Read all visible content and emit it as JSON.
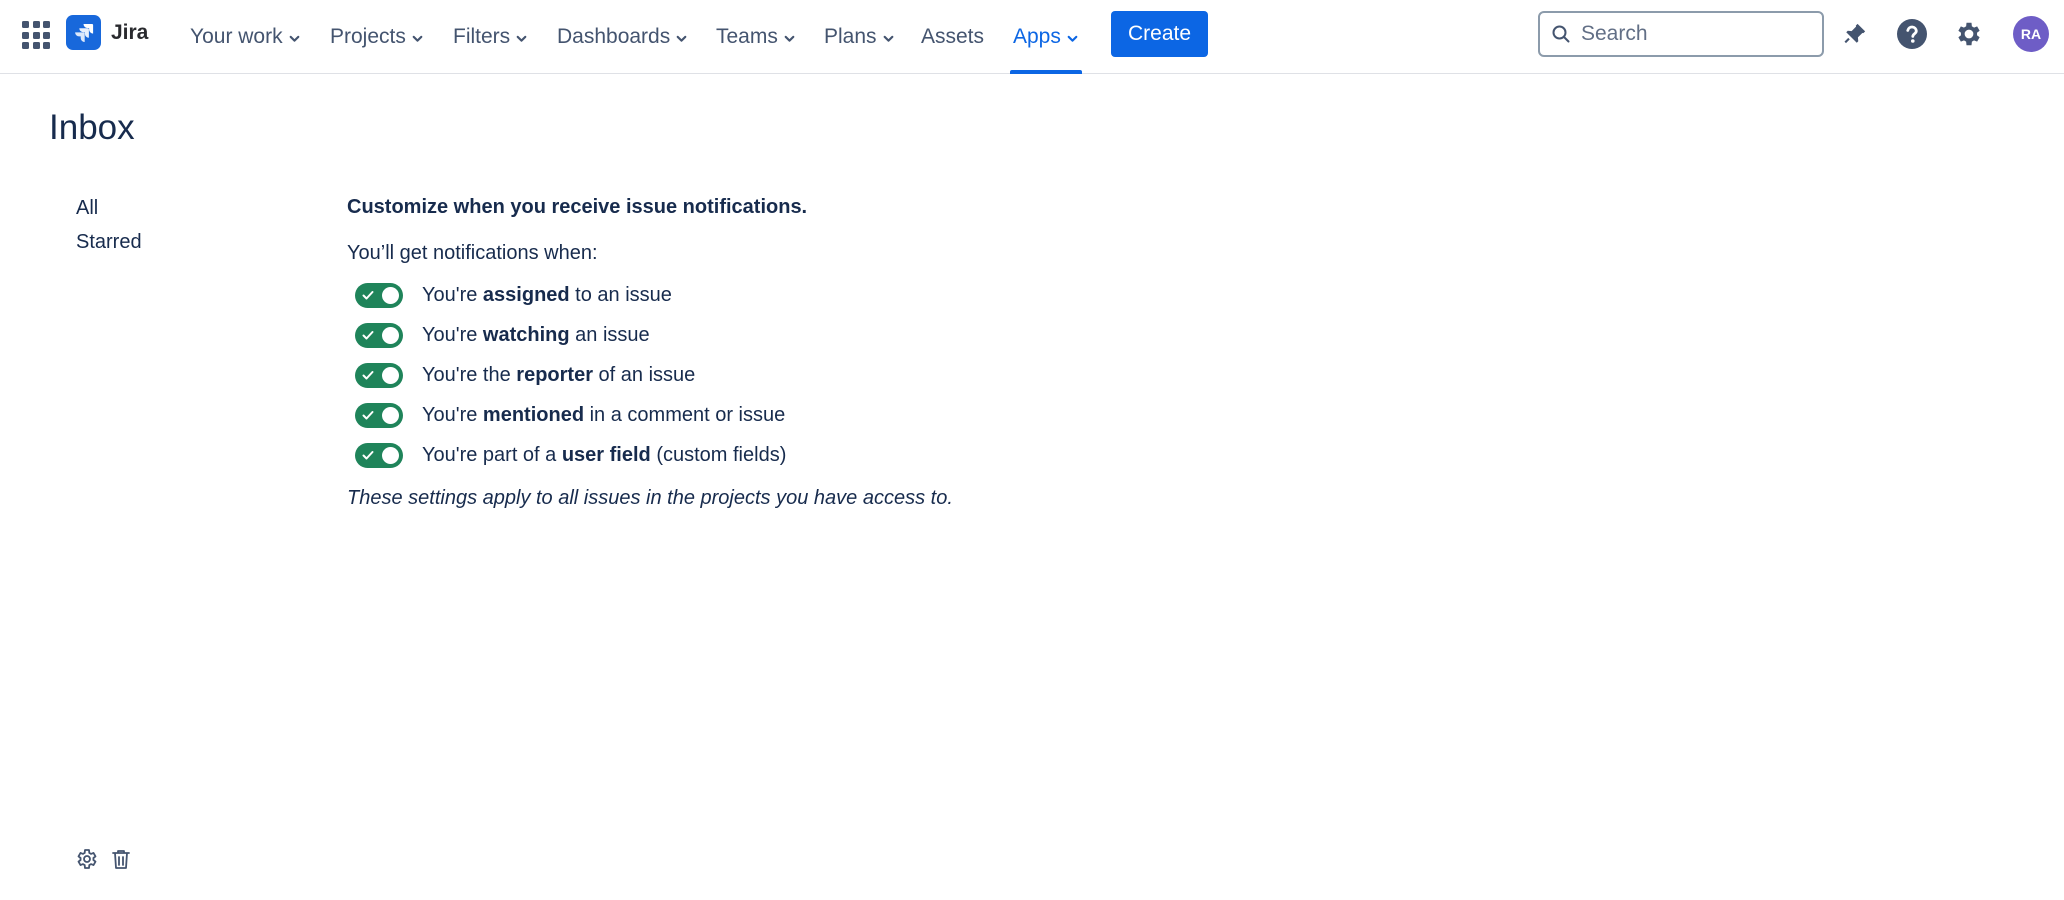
{
  "header": {
    "logo_text": "Jira",
    "nav": [
      {
        "label": "Your work",
        "dropdown": true
      },
      {
        "label": "Projects",
        "dropdown": true
      },
      {
        "label": "Filters",
        "dropdown": true
      },
      {
        "label": "Dashboards",
        "dropdown": true
      },
      {
        "label": "Teams",
        "dropdown": true
      },
      {
        "label": "Plans",
        "dropdown": true
      },
      {
        "label": "Assets",
        "dropdown": false
      },
      {
        "label": "Apps",
        "dropdown": true,
        "active": true
      }
    ],
    "create_label": "Create",
    "search_placeholder": "Search",
    "avatar_initials": "RA"
  },
  "page": {
    "title": "Inbox",
    "sidebar": [
      "All",
      "Starred"
    ],
    "heading": "Customize when you receive issue notifications.",
    "subheading": "You’ll get notifications when:",
    "rules": [
      {
        "pre": "You're ",
        "bold": "assigned",
        "post": " to an issue",
        "enabled": true
      },
      {
        "pre": "You're ",
        "bold": "watching",
        "post": " an issue",
        "enabled": true
      },
      {
        "pre": "You're the ",
        "bold": "reporter",
        "post": " of an issue",
        "enabled": true
      },
      {
        "pre": "You're ",
        "bold": "mentioned",
        "post": " in a comment or issue",
        "enabled": true
      },
      {
        "pre": "You're part of a ",
        "bold": "user field",
        "post": " (custom fields)",
        "enabled": true
      }
    ],
    "footnote": "These settings apply to all issues in the projects you have access to."
  },
  "colors": {
    "brand": "#0c66e4",
    "toggle_on": "#1f845a",
    "avatar": "#6e5dc6"
  },
  "icons": [
    "app-switcher-icon",
    "jira-logo-icon",
    "chevron-down-icon",
    "search-icon",
    "notification-bell-icon",
    "help-icon",
    "settings-gear-icon",
    "check-icon",
    "trash-icon"
  ]
}
